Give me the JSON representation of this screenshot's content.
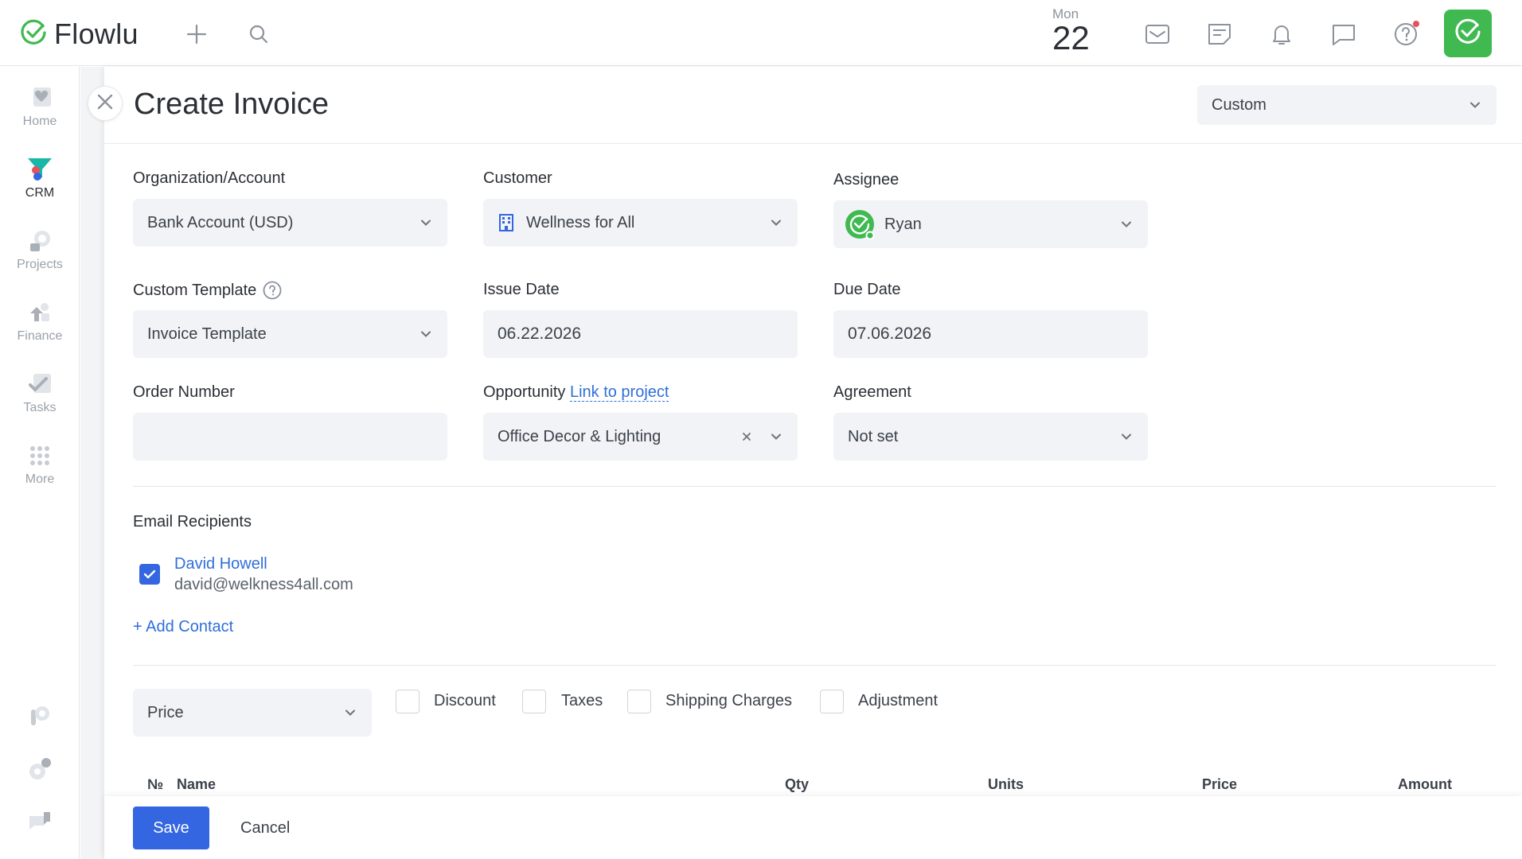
{
  "app": {
    "name": "Flowlu",
    "brand_color": "#3fb950",
    "accent_color": "#3366e0"
  },
  "header": {
    "date_day": "Mon",
    "date_num": "22",
    "icons": [
      "plus-icon",
      "search-icon",
      "mail-icon",
      "notes-icon",
      "bell-icon",
      "chat-icon",
      "help-icon",
      "app-check-icon"
    ]
  },
  "sidebar": {
    "items": [
      {
        "label": "Home",
        "icon": "home-icon"
      },
      {
        "label": "CRM",
        "icon": "crm-funnel-icon"
      },
      {
        "label": "Projects",
        "icon": "projects-icon"
      },
      {
        "label": "Finance",
        "icon": "finance-icon"
      },
      {
        "label": "Tasks",
        "icon": "tasks-icon"
      },
      {
        "label": "More",
        "icon": "more-grid-icon"
      }
    ],
    "bottom_icons": [
      "plugin-icon",
      "settings-icon",
      "support-chat-icon"
    ]
  },
  "form": {
    "title": "Create Invoice",
    "view_select": "Custom",
    "org_label": "Organization/Account",
    "org_value": "Bank Account (USD)",
    "customer_label": "Customer",
    "customer_value": "Wellness for All",
    "assignee_label": "Assignee",
    "assignee_value": "Ryan",
    "template_label": "Custom Template",
    "template_value": "Invoice Template",
    "issue_label": "Issue Date",
    "issue_value": "06.22.2026",
    "due_label": "Due Date",
    "due_value": "07.06.2026",
    "order_label": "Order Number",
    "order_value": "",
    "opportunity_label": "Opportunity",
    "opportunity_link": "Link to project",
    "opportunity_value": "Office Decor & Lighting",
    "agreement_label": "Agreement",
    "agreement_value": "Not set"
  },
  "recipients": {
    "label": "Email Recipients",
    "contacts": [
      {
        "name": "David Howell",
        "email": "david@welkness4all.com",
        "checked": true
      }
    ],
    "add_contact": "+ Add Contact"
  },
  "options": {
    "price_select": "Price",
    "checkboxes": [
      "Discount",
      "Taxes",
      "Shipping Charges",
      "Adjustment"
    ]
  },
  "table": {
    "columns": [
      "№",
      "Name",
      "Qty",
      "Units",
      "Price",
      "Amount"
    ]
  },
  "footer": {
    "save": "Save",
    "cancel": "Cancel"
  }
}
